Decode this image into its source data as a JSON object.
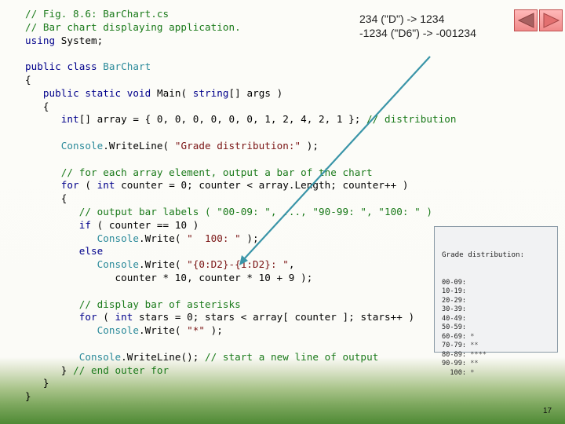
{
  "slide": {
    "page_number": "17",
    "format_note": {
      "line1": "234 (\"D\") -> 1234",
      "line2": "-1234 (\"D6\") -> -001234"
    },
    "navigation": {
      "prev_icon": "triangle-left-icon",
      "next_icon": "triangle-right-icon",
      "button_color": "#f29a9a",
      "arrow_color": "#3a95a8"
    }
  },
  "code": {
    "lines": [
      [
        {
          "t": "cm",
          "v": "// Fig. 8.6: BarChart.cs"
        }
      ],
      [
        {
          "t": "cm",
          "v": "// Bar chart displaying application."
        }
      ],
      [
        {
          "t": "kw",
          "v": "using"
        },
        {
          "t": "",
          "v": " System;"
        }
      ],
      [
        {
          "t": "",
          "v": ""
        }
      ],
      [
        {
          "t": "kw",
          "v": "public"
        },
        {
          "t": "",
          "v": " "
        },
        {
          "t": "kw",
          "v": "class"
        },
        {
          "t": "",
          "v": " "
        },
        {
          "t": "ty",
          "v": "BarChart"
        }
      ],
      [
        {
          "t": "",
          "v": "{"
        }
      ],
      [
        {
          "t": "",
          "v": "   "
        },
        {
          "t": "kw",
          "v": "public"
        },
        {
          "t": "",
          "v": " "
        },
        {
          "t": "kw",
          "v": "static"
        },
        {
          "t": "",
          "v": " "
        },
        {
          "t": "kw",
          "v": "void"
        },
        {
          "t": "",
          "v": " Main( "
        },
        {
          "t": "kw",
          "v": "string"
        },
        {
          "t": "",
          "v": "[] args )"
        }
      ],
      [
        {
          "t": "",
          "v": "   {"
        }
      ],
      [
        {
          "t": "",
          "v": "      "
        },
        {
          "t": "kw",
          "v": "int"
        },
        {
          "t": "",
          "v": "[] array = { 0, 0, 0, 0, 0, 0, 1, 2, 4, 2, 1 }; "
        },
        {
          "t": "cm",
          "v": "// distribution"
        }
      ],
      [
        {
          "t": "",
          "v": ""
        }
      ],
      [
        {
          "t": "",
          "v": "      "
        },
        {
          "t": "ty",
          "v": "Console"
        },
        {
          "t": "",
          "v": ".WriteLine( "
        },
        {
          "t": "st",
          "v": "\"Grade distribution:\""
        },
        {
          "t": "",
          "v": " );"
        }
      ],
      [
        {
          "t": "",
          "v": ""
        }
      ],
      [
        {
          "t": "",
          "v": "      "
        },
        {
          "t": "cm",
          "v": "// for each array element, output a bar of the chart"
        }
      ],
      [
        {
          "t": "",
          "v": "      "
        },
        {
          "t": "kw",
          "v": "for"
        },
        {
          "t": "",
          "v": " ( "
        },
        {
          "t": "kw",
          "v": "int"
        },
        {
          "t": "",
          "v": " counter = 0; counter < array.Length; counter++ )"
        }
      ],
      [
        {
          "t": "",
          "v": "      {"
        }
      ],
      [
        {
          "t": "",
          "v": "         "
        },
        {
          "t": "cm",
          "v": "// output bar labels ( \"00-09: \", ..., \"90-99: \", \"100: \" )"
        }
      ],
      [
        {
          "t": "",
          "v": "         "
        },
        {
          "t": "kw",
          "v": "if"
        },
        {
          "t": "",
          "v": " ( counter == 10 )"
        }
      ],
      [
        {
          "t": "",
          "v": "            "
        },
        {
          "t": "ty",
          "v": "Console"
        },
        {
          "t": "",
          "v": ".Write( "
        },
        {
          "t": "st",
          "v": "\"  100: \""
        },
        {
          "t": "",
          "v": " );"
        }
      ],
      [
        {
          "t": "",
          "v": "         "
        },
        {
          "t": "kw",
          "v": "else"
        }
      ],
      [
        {
          "t": "",
          "v": "            "
        },
        {
          "t": "ty",
          "v": "Console"
        },
        {
          "t": "",
          "v": ".Write( "
        },
        {
          "t": "st",
          "v": "\"{0:D2}-{1:D2}: \""
        },
        {
          "t": "",
          "v": ","
        }
      ],
      [
        {
          "t": "",
          "v": "               counter * 10, counter * 10 + 9 );"
        }
      ],
      [
        {
          "t": "",
          "v": ""
        }
      ],
      [
        {
          "t": "",
          "v": "         "
        },
        {
          "t": "cm",
          "v": "// display bar of asterisks"
        }
      ],
      [
        {
          "t": "",
          "v": "         "
        },
        {
          "t": "kw",
          "v": "for"
        },
        {
          "t": "",
          "v": " ( "
        },
        {
          "t": "kw",
          "v": "int"
        },
        {
          "t": "",
          "v": " stars = 0; stars < array[ counter ]; stars++ )"
        }
      ],
      [
        {
          "t": "",
          "v": "            "
        },
        {
          "t": "ty",
          "v": "Console"
        },
        {
          "t": "",
          "v": ".Write( "
        },
        {
          "t": "st",
          "v": "\"*\""
        },
        {
          "t": "",
          "v": " );"
        }
      ],
      [
        {
          "t": "",
          "v": ""
        }
      ],
      [
        {
          "t": "",
          "v": "         "
        },
        {
          "t": "ty",
          "v": "Console"
        },
        {
          "t": "",
          "v": ".WriteLine(); "
        },
        {
          "t": "cm",
          "v": "// start a new line of output"
        }
      ],
      [
        {
          "t": "",
          "v": "      } "
        },
        {
          "t": "cm",
          "v": "// end outer for"
        }
      ],
      [
        {
          "t": "",
          "v": "   }"
        }
      ],
      [
        {
          "t": "",
          "v": "}"
        }
      ]
    ]
  },
  "console_output": {
    "header": "Grade distribution:",
    "rows": [
      {
        "label": "00-09:",
        "stars": ""
      },
      {
        "label": "10-19:",
        "stars": ""
      },
      {
        "label": "20-29:",
        "stars": ""
      },
      {
        "label": "30-39:",
        "stars": ""
      },
      {
        "label": "40-49:",
        "stars": ""
      },
      {
        "label": "50-59:",
        "stars": ""
      },
      {
        "label": "60-69:",
        "stars": "*"
      },
      {
        "label": "70-79:",
        "stars": "**"
      },
      {
        "label": "80-89:",
        "stars": "****"
      },
      {
        "label": "90-99:",
        "stars": "**"
      },
      {
        "label": "  100:",
        "stars": "*"
      }
    ]
  }
}
